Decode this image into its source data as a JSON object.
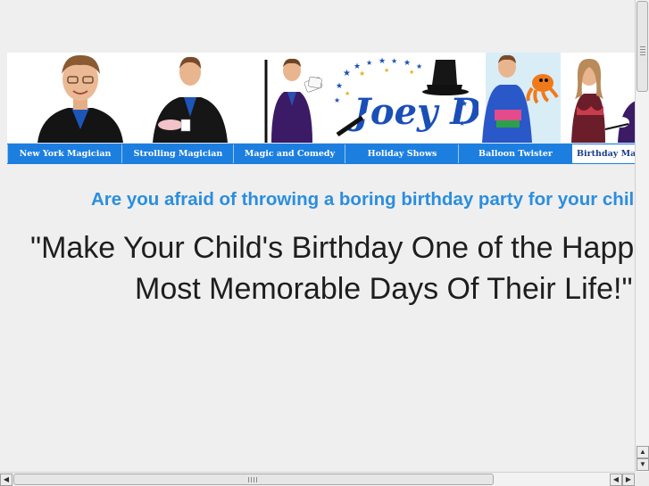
{
  "banner": {
    "logo_text": "Joey D.",
    "photos": [
      "portrait-photo",
      "strolling-photo",
      "cane-photo",
      "logo",
      "balloon-photo",
      "birthday-photo"
    ]
  },
  "nav": {
    "items": [
      {
        "label": "New York Magician"
      },
      {
        "label": "Strolling Magician"
      },
      {
        "label": "Magic and Comedy"
      },
      {
        "label": "Holiday Shows"
      },
      {
        "label": "Balloon Twister"
      },
      {
        "label": "Birthday Magician"
      }
    ],
    "active_index": 5
  },
  "content": {
    "headline": "Are you afraid of throwing a boring birthday party for your child?",
    "quote_line1": "\"Make Your Child's Birthday One of the Happiest",
    "quote_line2": "Most Memorable Days Of Their Life!\""
  },
  "colors": {
    "nav_bg": "#1c7fe0",
    "headline": "#2a8ee0",
    "quote": "#1e1e1e",
    "page_bg": "#efefef"
  },
  "scrollbars": {
    "vertical_up_icon": "arrow-up-icon",
    "vertical_down_icon": "arrow-down-icon",
    "horizontal_left_icon": "arrow-left-icon",
    "horizontal_right_icon": "arrow-right-icon"
  }
}
